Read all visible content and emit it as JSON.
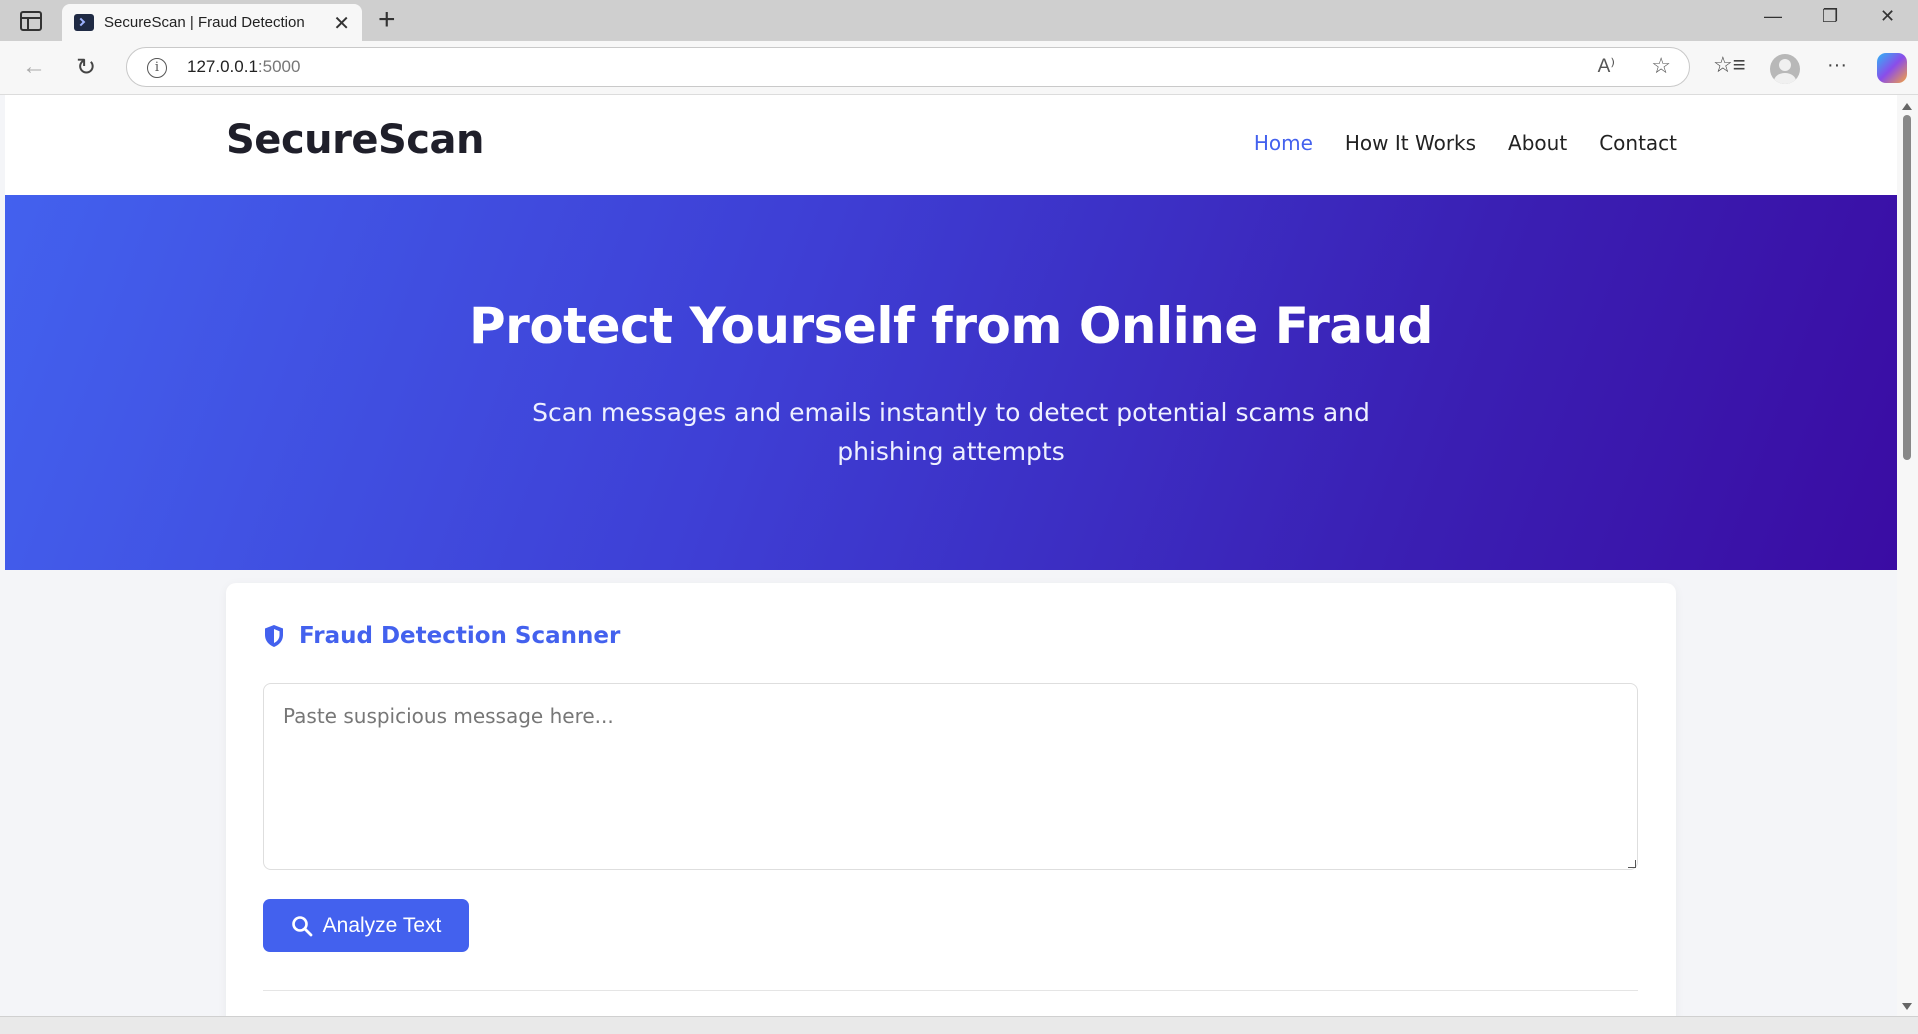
{
  "browser": {
    "tab_title": "SecureScan | Fraud Detection",
    "tab_close": "✕",
    "new_tab": "+",
    "url_host": "127.0.0.1",
    "url_port": ":5000",
    "window_controls": {
      "minimize": "—",
      "restore": "❐",
      "close": "✕"
    }
  },
  "site": {
    "logo": "SecureScan",
    "nav": [
      {
        "label": "Home",
        "active": true
      },
      {
        "label": "How It Works",
        "active": false
      },
      {
        "label": "About",
        "active": false
      },
      {
        "label": "Contact",
        "active": false
      }
    ]
  },
  "hero": {
    "title": "Protect Yourself from Online Fraud",
    "subtitle": "Scan messages and emails instantly to detect potential scams and phishing attempts"
  },
  "scanner": {
    "title": "Fraud Detection Scanner",
    "placeholder": "Paste suspicious message here...",
    "value": "",
    "button_label": "Analyze Text"
  },
  "colors": {
    "accent": "#4361ee",
    "hero_gradient_start": "#4361ee",
    "hero_gradient_end": "#3a0ca3"
  },
  "icons": {
    "shield": "shield-icon",
    "search": "search-icon"
  }
}
